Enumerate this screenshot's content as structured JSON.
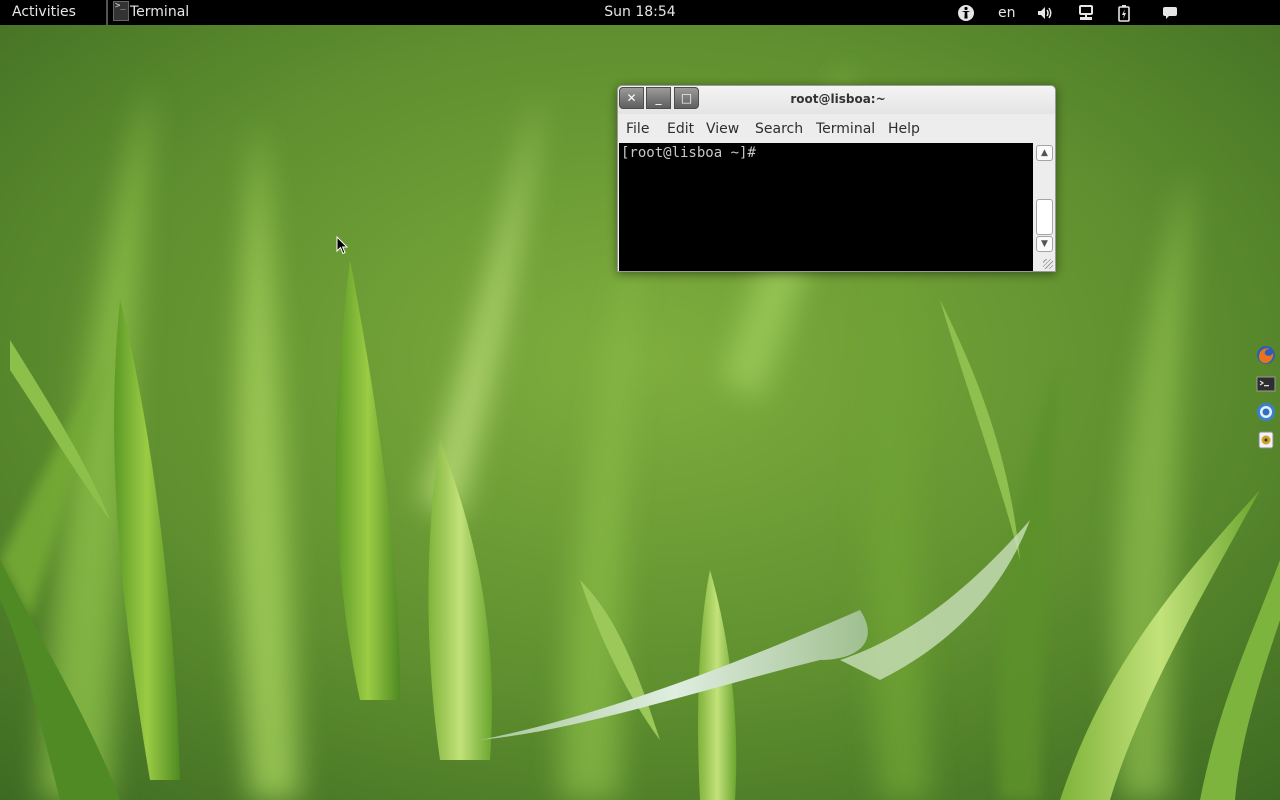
{
  "topbar": {
    "activities_label": "Activities",
    "app_menu_label": "Terminal",
    "app_icon_glyph": ">_",
    "clock": "Sun 18:54",
    "keyboard_layout": "en",
    "tray_icons": [
      "accessibility-icon",
      "volume-icon",
      "network-icon",
      "battery-icon",
      "chat-icon"
    ]
  },
  "terminal_window": {
    "title": "root@lisboa:~",
    "buttons": {
      "close": "✕",
      "minimize": "_",
      "maximize": "□"
    },
    "menu": [
      "File",
      "Edit",
      "View",
      "Search",
      "Terminal",
      "Help"
    ],
    "prompt": "[root@lisboa ~]#",
    "scroll_up": "▲",
    "scroll_down": "▼"
  },
  "side_tray": [
    "firefox-icon",
    "terminal-icon",
    "chromium-icon",
    "media-player-icon"
  ],
  "colors": {
    "topbar_bg": "#000000",
    "terminal_bg": "#000000",
    "terminal_fg": "#c7c7c7",
    "window_bg": "#ededed",
    "wallpaper_green": "#6f9a3c"
  }
}
